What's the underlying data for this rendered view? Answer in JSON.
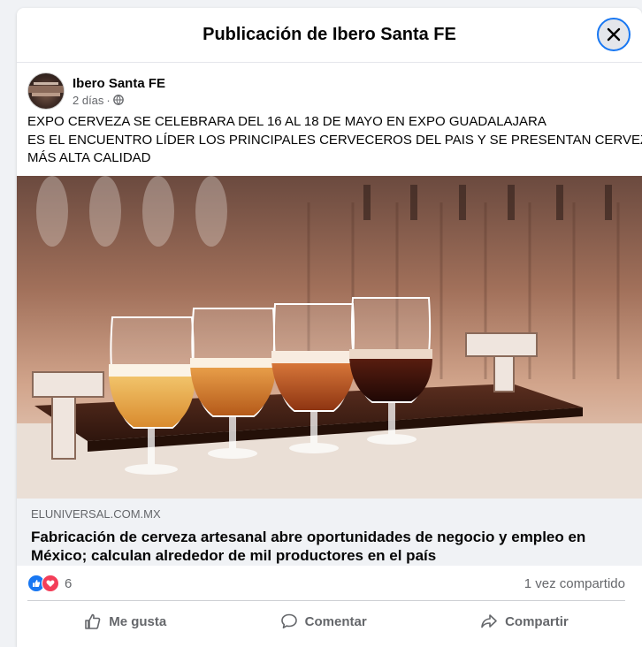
{
  "modal": {
    "title": "Publicación de Ibero Santa FE"
  },
  "post": {
    "author": "Ibero Santa FE",
    "time": "2 días",
    "separator": "·",
    "privacy_icon": "globe-icon",
    "text_lines": [
      "EXPO CERVEZA SE CELEBRARA DEL 16 AL 18 DE MAYO EN EXPO GUADALAJARA",
      "ES EL ENCUENTRO LÍDER LOS PRINCIPALES CERVECEROS DEL PAIS Y SE PRESENTAN CERVEZAS DE LA",
      "MÁS ALTA CALIDAD"
    ]
  },
  "link": {
    "domain": "ELUNIVERSAL.COM.MX",
    "title_line1": "Fabricación de cerveza artesanal abre oportunidades de negocio y empleo en",
    "title_line2": "México; calculan alrededor de mil productores en el país"
  },
  "stats": {
    "reaction_count": "6",
    "reaction_icons": [
      "like-icon",
      "love-icon"
    ],
    "shares": "1 vez compartido"
  },
  "actions": {
    "like": "Me gusta",
    "comment": "Comentar",
    "share": "Compartir"
  },
  "colors": {
    "accent": "#1877f2",
    "love": "#f33e58",
    "secondary_text": "#65676b"
  }
}
